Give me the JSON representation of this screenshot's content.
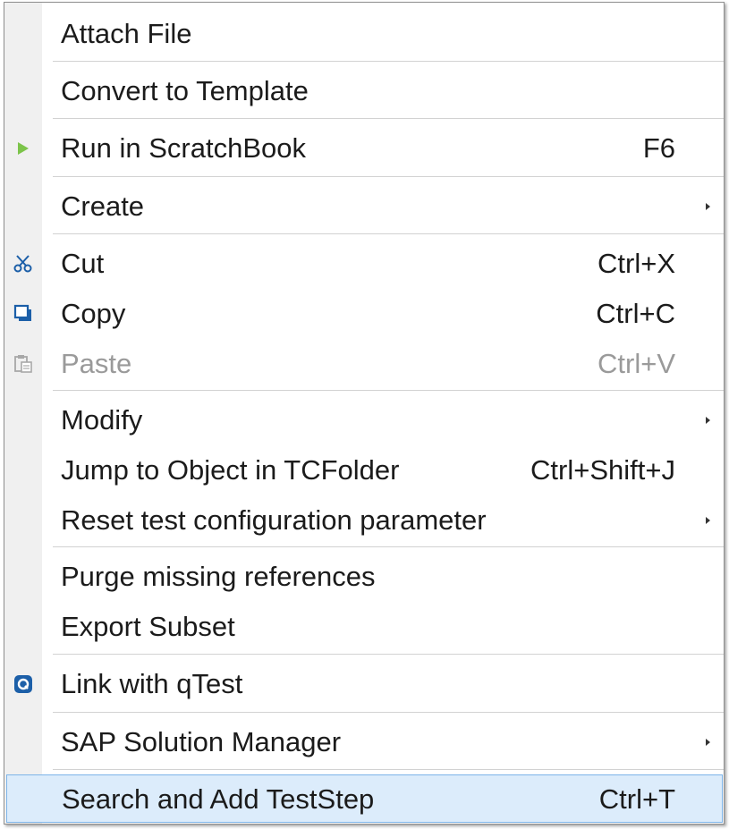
{
  "menu": {
    "attach_file": {
      "label": "Attach File"
    },
    "convert_template": {
      "label": "Convert to Template"
    },
    "run_scratchbook": {
      "label": "Run in ScratchBook",
      "shortcut": "F6",
      "icon": "play-icon"
    },
    "create": {
      "label": "Create",
      "submenu": true
    },
    "cut": {
      "label": "Cut",
      "shortcut": "Ctrl+X",
      "icon": "scissors-icon"
    },
    "copy": {
      "label": "Copy",
      "shortcut": "Ctrl+C",
      "icon": "copy-icon"
    },
    "paste": {
      "label": "Paste",
      "shortcut": "Ctrl+V",
      "icon": "paste-icon",
      "disabled": true
    },
    "modify": {
      "label": "Modify",
      "submenu": true
    },
    "jump_object": {
      "label": "Jump to Object in TCFolder",
      "shortcut": "Ctrl+Shift+J"
    },
    "reset_param": {
      "label": "Reset test configuration parameter",
      "submenu": true
    },
    "purge_refs": {
      "label": "Purge missing references"
    },
    "export_subset": {
      "label": "Export Subset"
    },
    "link_qtest": {
      "label": "Link with qTest",
      "icon": "qtest-icon"
    },
    "sap_manager": {
      "label": "SAP Solution Manager",
      "submenu": true
    },
    "search_add": {
      "label": "Search and Add TestStep",
      "shortcut": "Ctrl+T",
      "highlighted": true
    }
  },
  "colors": {
    "highlight_bg": "#dcecfb",
    "highlight_border": "#7db4e8",
    "gutter": "#f0f0f0",
    "play_green": "#7cc44a",
    "icon_blue": "#1c5fa8",
    "disabled_text": "#9a9a9a"
  }
}
